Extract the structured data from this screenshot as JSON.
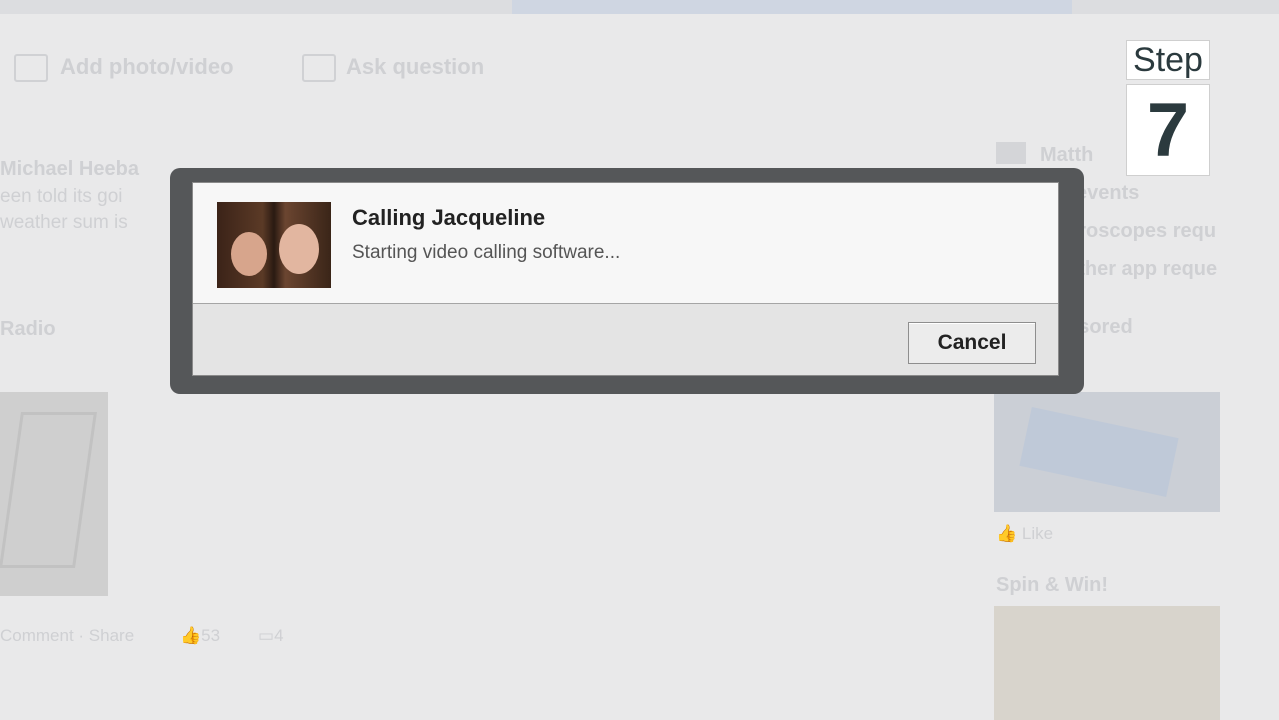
{
  "background": {
    "add_photo_video": "Add photo/video",
    "ask_question": "Ask question",
    "post_author_partial": "Michael Heeba",
    "post_line1_partial": "een told its goi",
    "post_line2_partial": "weather sum is",
    "section_left_partial": "Radio",
    "right_name_partial": "Matth",
    "right_events_partial": "events",
    "right_horoscopes_partial": "oroscopes requ",
    "right_other_partial": "other app reque",
    "right_sponsored_partial": "nsored",
    "right_like": "Like",
    "spin_win": "Spin & Win!",
    "post_actions": "Comment · Share",
    "post_likes": "53",
    "post_comments": "4"
  },
  "step": {
    "label": "Step",
    "number": "7"
  },
  "dialog": {
    "title": "Calling Jacqueline",
    "message": "Starting video calling software...",
    "cancel_label": "Cancel"
  }
}
